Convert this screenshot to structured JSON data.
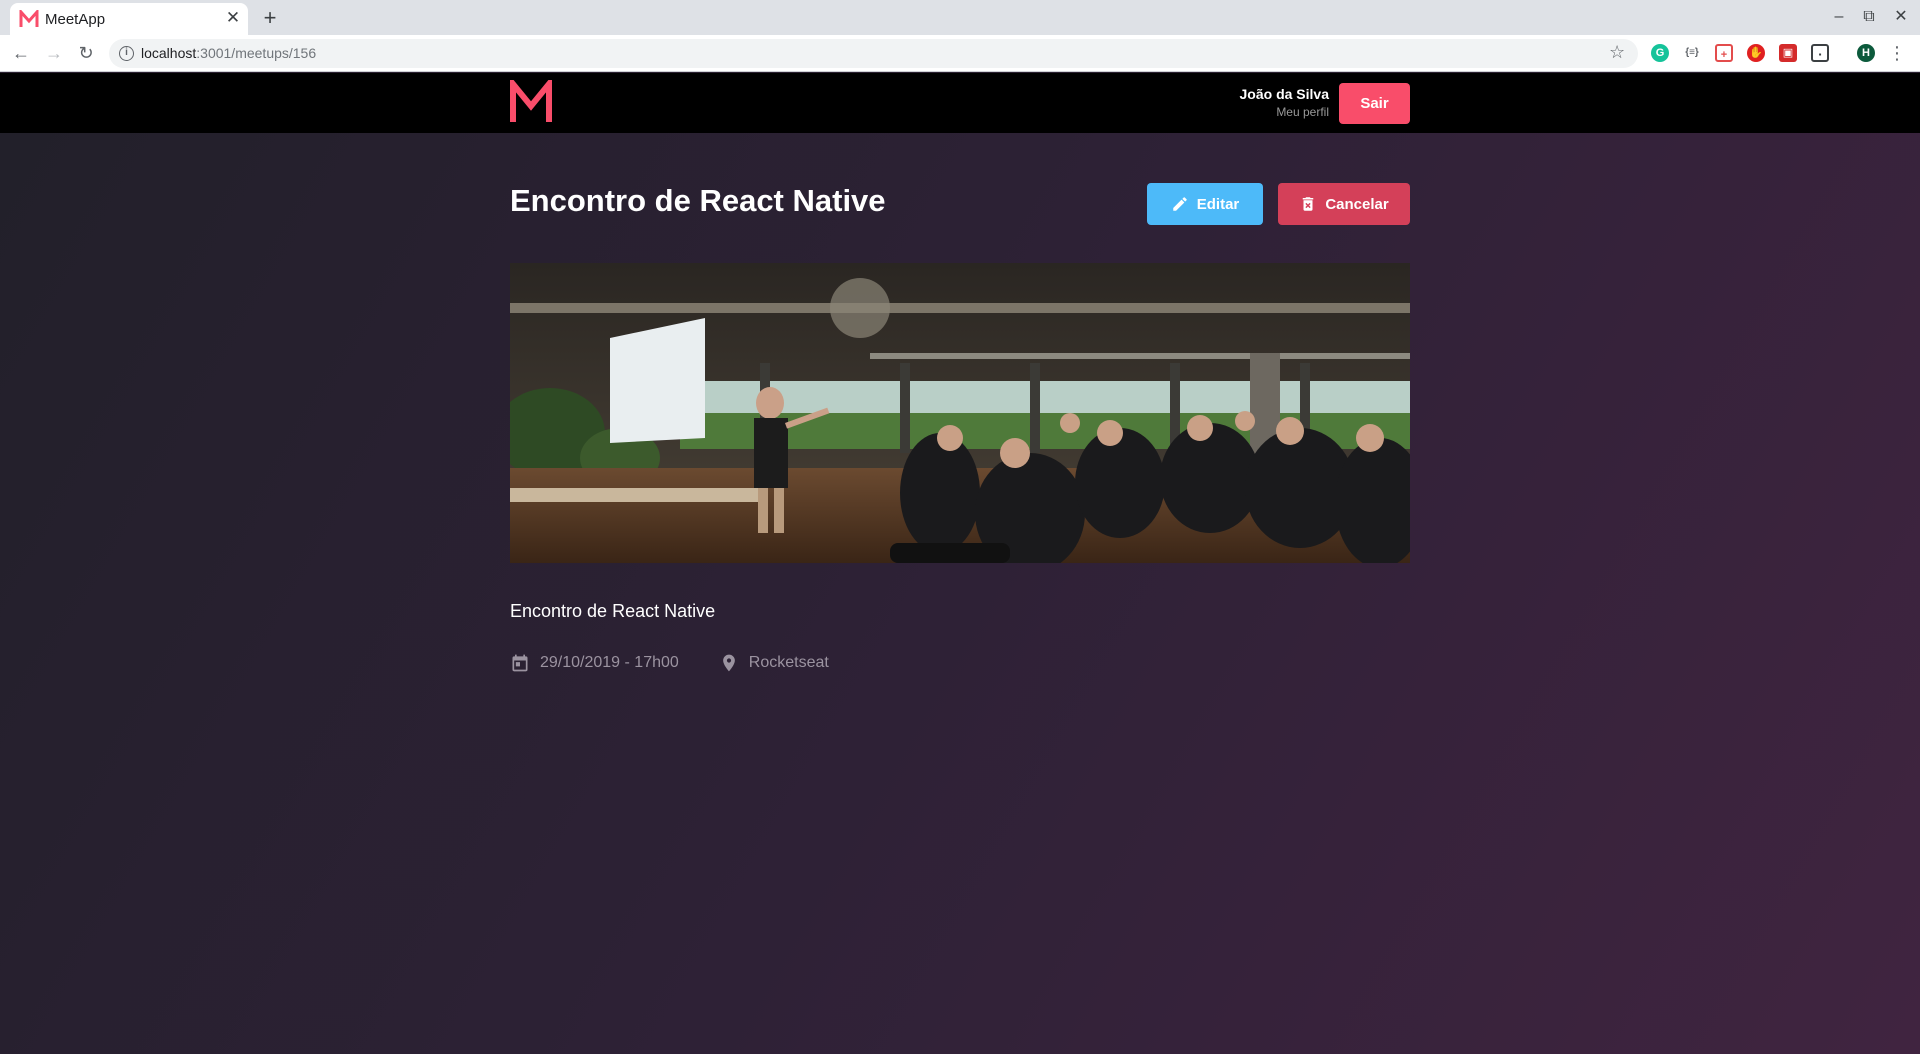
{
  "browser": {
    "tab_title": "MeetApp",
    "url_host": "localhost",
    "url_path": ":3001/meetups/156",
    "profile_initial": "H"
  },
  "header": {
    "logo_letter": "M",
    "user_name": "João da Silva",
    "profile_link": "Meu perfil",
    "logout_label": "Sair"
  },
  "meetup": {
    "title": "Encontro de React Native",
    "edit_label": "Editar",
    "cancel_label": "Cancelar",
    "description": "Encontro de React Native",
    "date": "29/10/2019 - 17h00",
    "location": "Rocketseat"
  },
  "colors": {
    "brand": "#f94d6a",
    "edit": "#4dbaf9",
    "cancel": "#d44059",
    "header_bg": "#000000"
  },
  "icons": {
    "edit": "pencil-icon",
    "cancel": "trash-icon",
    "date": "calendar-icon",
    "location": "location-pin-icon"
  }
}
